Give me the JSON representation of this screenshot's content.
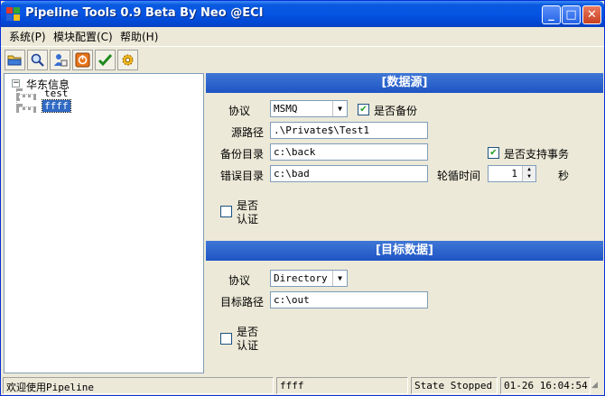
{
  "window": {
    "title": "Pipeline Tools 0.9 Beta By Neo @ECI",
    "minimize_glyph": "_",
    "maximize_glyph": "□",
    "close_glyph": "✕"
  },
  "menu": {
    "items": [
      "系统(P)",
      "模块配置(C)",
      "帮助(H)"
    ]
  },
  "toolbar": {
    "buttons": [
      "folder-icon",
      "search-icon",
      "user-icon",
      "stop-icon",
      "check-icon",
      "gear-icon"
    ]
  },
  "tree": {
    "toggle": "−",
    "root": "华东信息",
    "children": [
      "test",
      "ffff"
    ],
    "selected": "ffff"
  },
  "source": {
    "header": "[数据源]",
    "protocol_label": "协议",
    "protocol_value": "MSMQ",
    "backup_label": "是否备份",
    "backup_checked": "✔",
    "path_label": "源路径",
    "path_value": ".\\Private$\\Test1",
    "backup_dir_label": "备份目录",
    "backup_dir_value": "c:\\back",
    "transaction_label": "是否支持事务",
    "transaction_checked": "✔",
    "error_dir_label": "错误目录",
    "error_dir_value": "c:\\bad",
    "poll_label": "轮循时间",
    "poll_value": "1",
    "poll_unit": "秒",
    "auth_label_1": "是否",
    "auth_label_2": "认证"
  },
  "target": {
    "header": "[目标数据]",
    "protocol_label": "协议",
    "protocol_value": "Directory",
    "path_label": "目标路径",
    "path_value": "c:\\out",
    "auth_label_1": "是否",
    "auth_label_2": "认证"
  },
  "status": {
    "message": "欢迎使用Pipeline",
    "current": "ffff",
    "state": "State Stopped",
    "time": "01-26 16:04:54"
  },
  "colors": {
    "title_bar": "#0554e3",
    "section_header": "#2e63cc",
    "selection": "#316ac5"
  }
}
